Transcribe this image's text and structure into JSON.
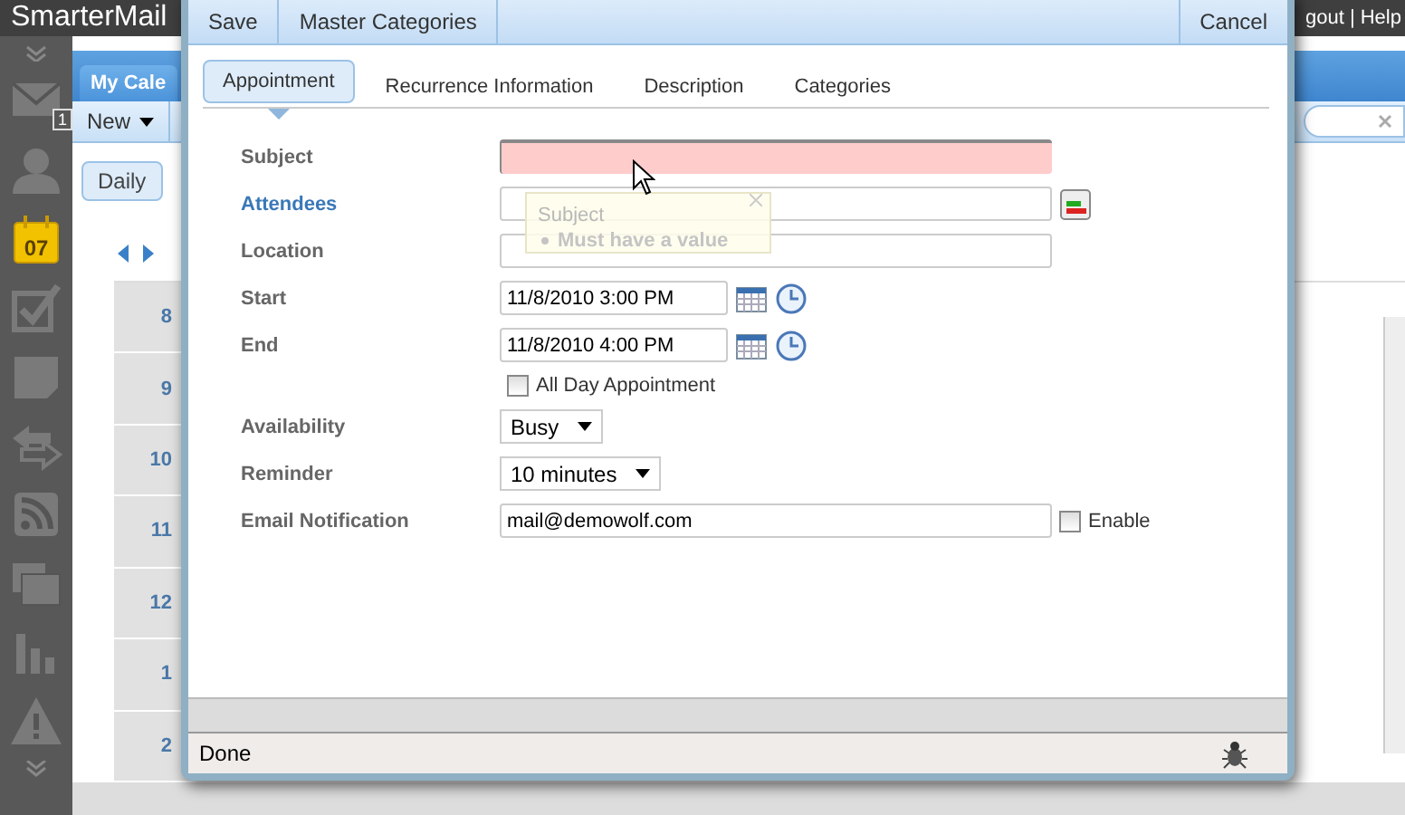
{
  "app": {
    "title": "SmarterMail",
    "header_links": "gout | Help",
    "sidebar": [
      {
        "kind": "mail",
        "badge": "1",
        "selected": false
      },
      {
        "kind": "contacts",
        "selected": false
      },
      {
        "kind": "calendar",
        "label": "07",
        "selected": true
      },
      {
        "kind": "tasks",
        "selected": false
      },
      {
        "kind": "notes",
        "selected": false
      },
      {
        "kind": "sync",
        "selected": false
      },
      {
        "kind": "feeds",
        "selected": false
      },
      {
        "kind": "files",
        "selected": false
      },
      {
        "kind": "reports",
        "selected": false
      },
      {
        "kind": "alerts",
        "selected": false
      }
    ]
  },
  "calendar": {
    "tab": "My Cale",
    "toolbar": [
      "New"
    ],
    "view_tabs": [
      {
        "label": "Daily",
        "selected": true
      }
    ],
    "hours": [
      "8",
      "9",
      "10",
      "11",
      "12",
      "1",
      "2"
    ]
  },
  "dialog": {
    "toolbar": {
      "left": [
        "Save",
        "Master Categories"
      ],
      "right": [
        "Cancel"
      ]
    },
    "tabs": [
      {
        "label": "Appointment",
        "selected": true
      },
      {
        "label": "Recurrence Information",
        "selected": false
      },
      {
        "label": "Description",
        "selected": false
      },
      {
        "label": "Categories",
        "selected": false
      }
    ],
    "fields": [
      {
        "kind": "text",
        "label": "Subject",
        "link": false,
        "invalid": true
      },
      {
        "kind": "picker",
        "label": "Attendees",
        "link": true,
        "invalid": false
      },
      {
        "kind": "text",
        "label": "Location",
        "link": false,
        "invalid": false
      },
      {
        "kind": "datetime",
        "label": "Start",
        "value": "11/8/2010 3:00 PM",
        "link": false,
        "invalid": false
      },
      {
        "kind": "datetime",
        "label": "End",
        "value": "11/8/2010 4:00 PM",
        "link": false,
        "invalid": false
      },
      {
        "kind": "checkbox",
        "text": "All Day Appointment",
        "checked": false
      },
      {
        "kind": "select",
        "label": "Availability",
        "value": "Busy",
        "link": false,
        "invalid": false
      },
      {
        "kind": "select",
        "label": "Reminder",
        "value": "10 minutes",
        "link": false,
        "invalid": false
      },
      {
        "kind": "notify",
        "label": "Email Notification",
        "value": "mail@demowolf.com",
        "option": "Enable",
        "checked": false,
        "link": false,
        "invalid": false
      }
    ],
    "validation_tooltip": {
      "title": "Subject",
      "messages": [
        "Must have a value"
      ]
    },
    "status_bar": {
      "text": "Done"
    }
  }
}
